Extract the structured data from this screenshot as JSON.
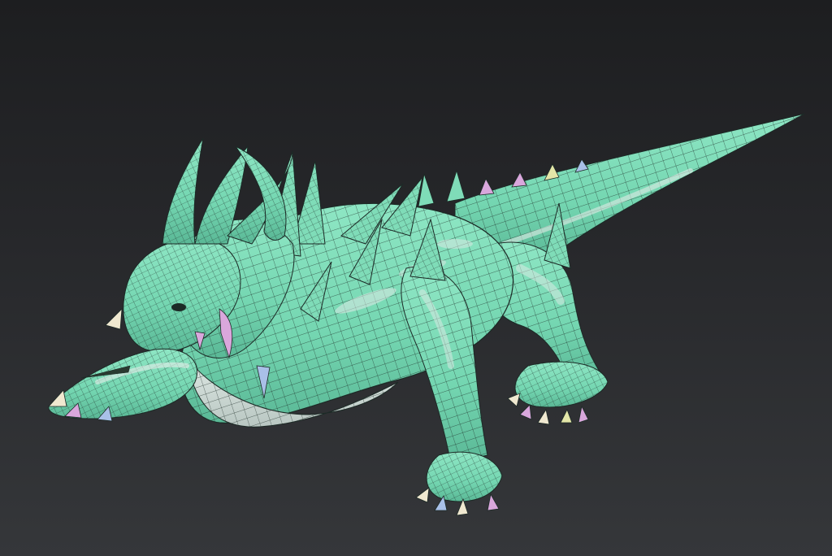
{
  "viewport": {
    "background_top": "#1d1e20",
    "background_bottom": "#35373a"
  },
  "model": {
    "subject": "dragon-mesh",
    "display": "smooth-shaded-with-wireframe",
    "colors": {
      "skin": "#7fdcb8",
      "skin_dark": "#5cbf9c",
      "skin_highlight": "#c8f0e0",
      "belly": "#e6ecea",
      "wire": "#1c2a26",
      "spike_pink": "#d9a7dc",
      "spike_yellow": "#e3e6a8",
      "spike_blue": "#a9c0e8",
      "claw": "#f0e8d0"
    }
  }
}
